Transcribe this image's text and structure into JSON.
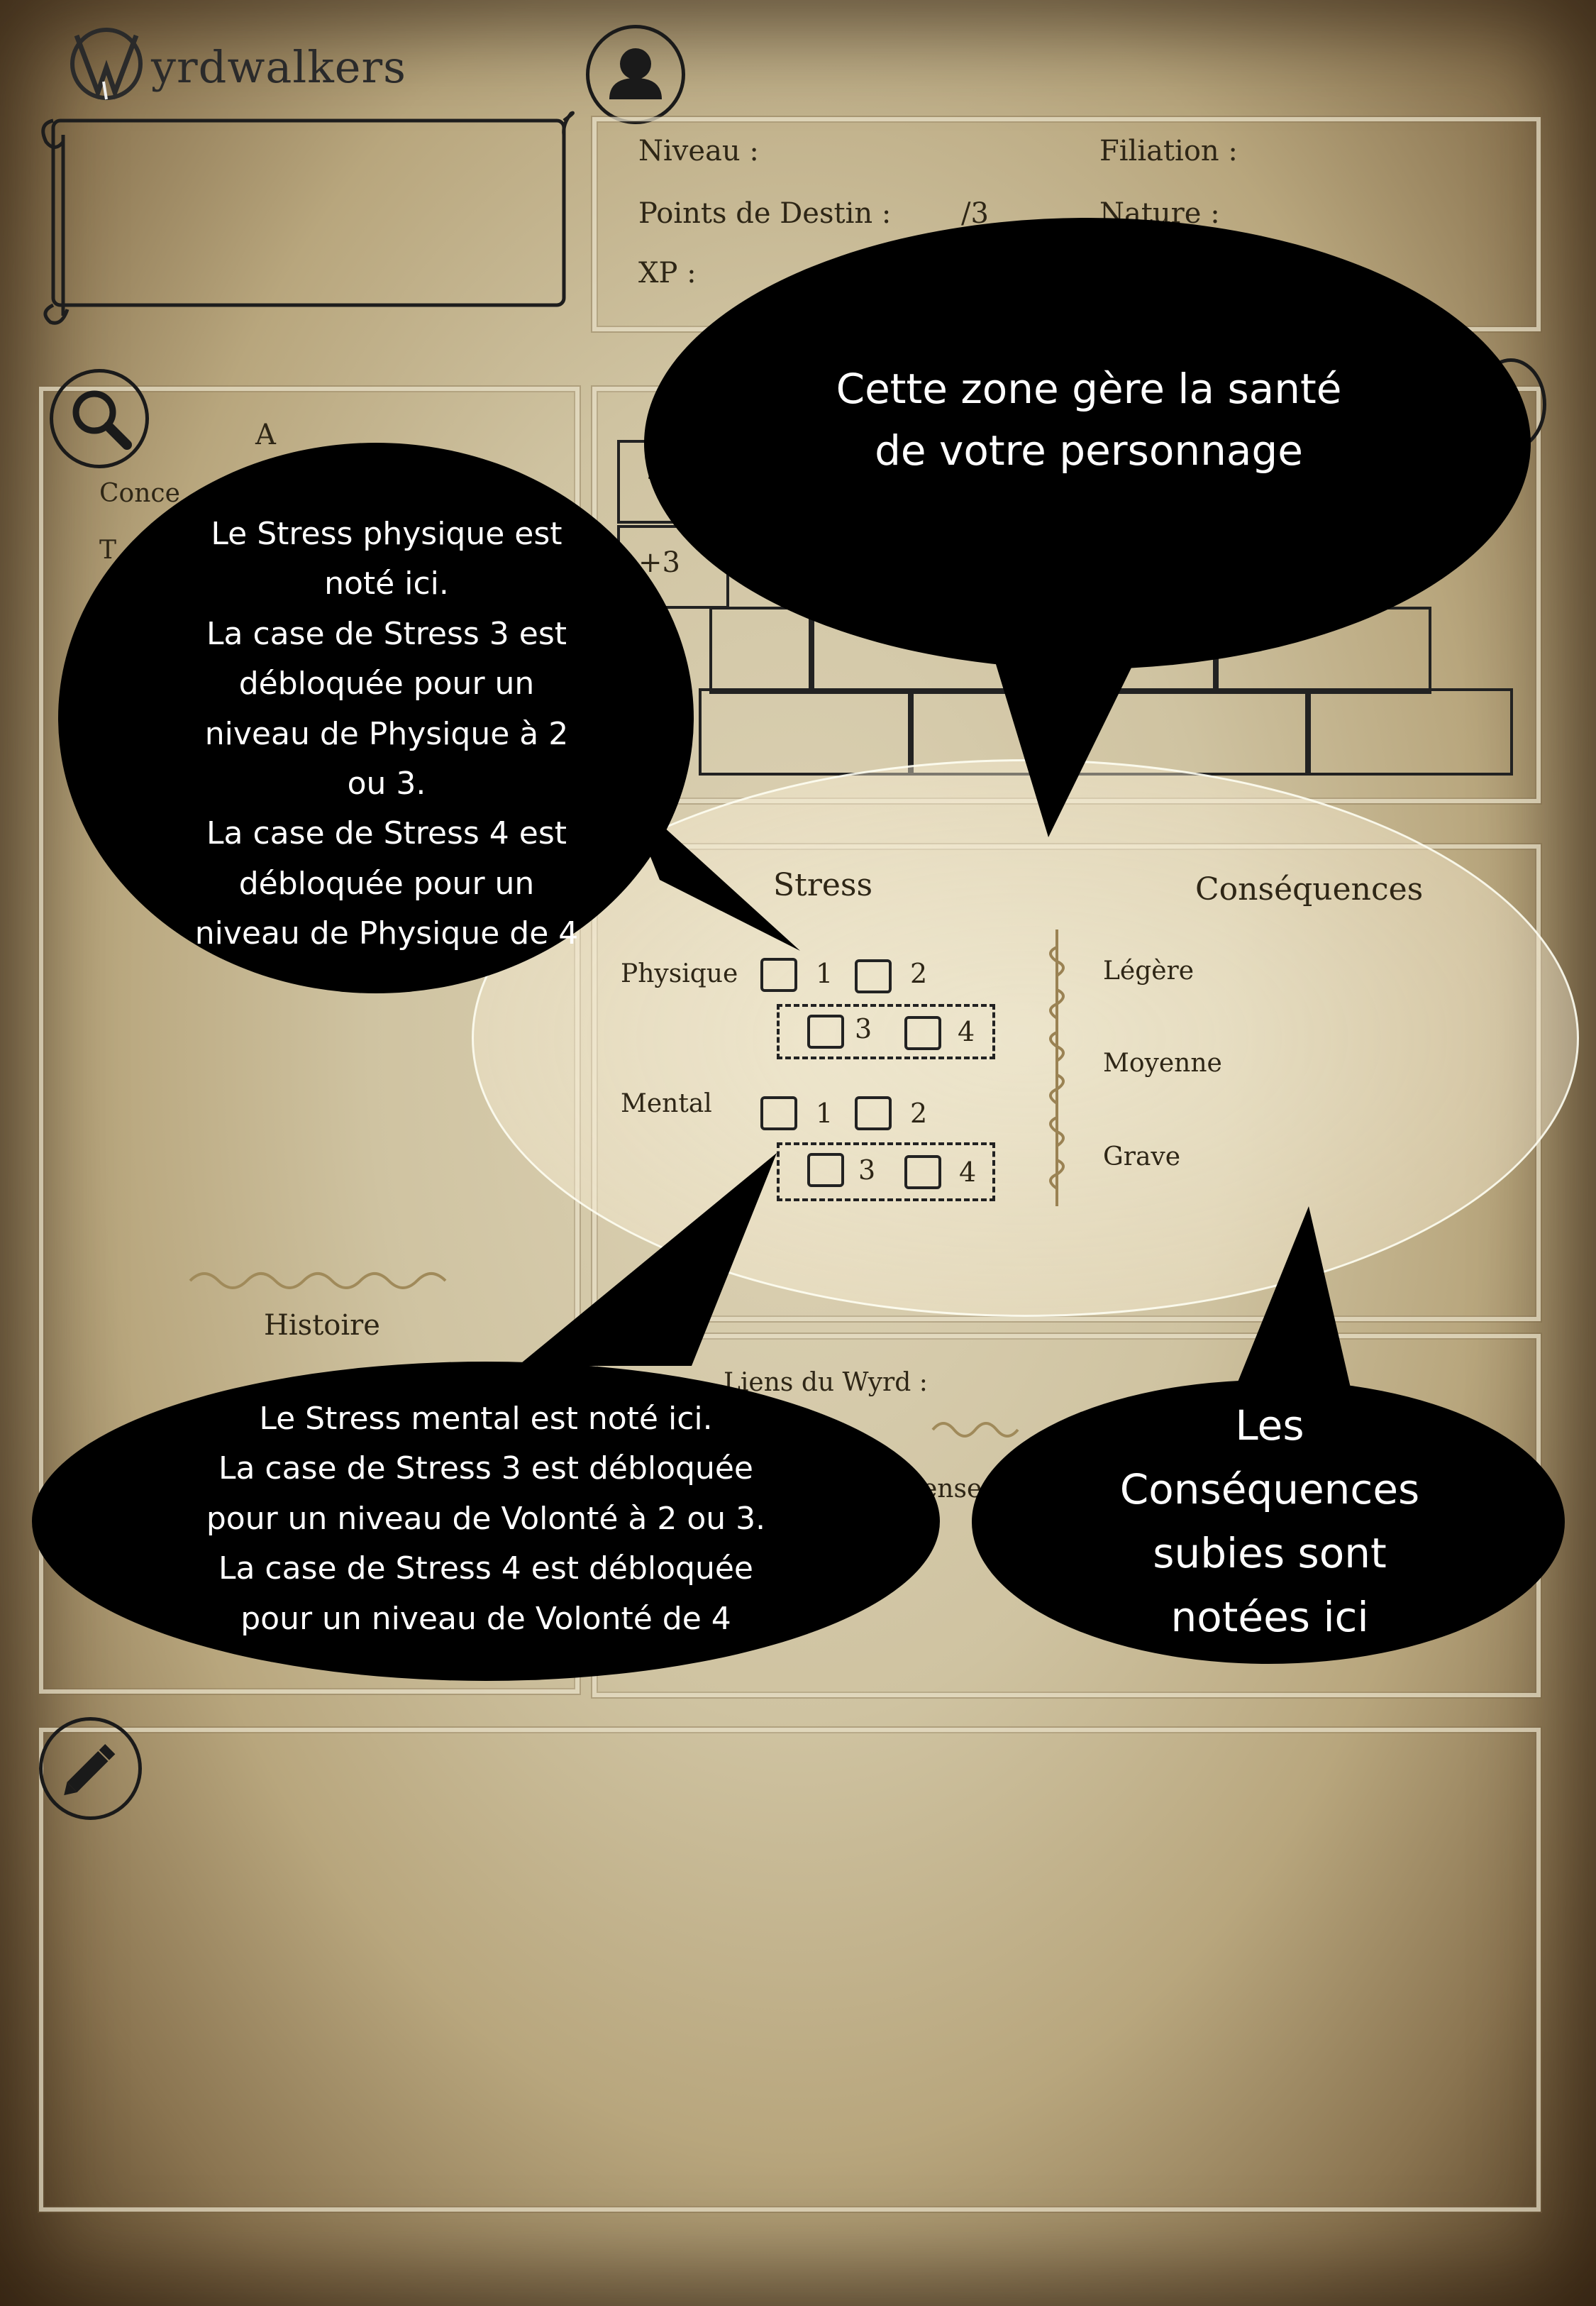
{
  "logo": {
    "text": "Wyrdwalkers",
    "first_letter": "W",
    "rest": "yrdwalkers"
  },
  "header_fields": {
    "niveau": "Niveau :",
    "points_destin": "Points de Destin :",
    "points_destin_value": "/3",
    "xp": "XP :",
    "filiation": "Filiation :",
    "nature": "Nature :"
  },
  "aspects_partial": {
    "a_letter": "A",
    "concept": "Conce",
    "t_letter": "T"
  },
  "skills_partial": {
    "plus4": "+",
    "plus3": "+3"
  },
  "health": {
    "stress_title": "Stress",
    "consequences_title": "Conséquences",
    "physique": "Physique",
    "mental": "Mental",
    "box1": "1",
    "box2": "2",
    "box3": "3",
    "box4": "4",
    "legere": "Légère",
    "moyenne": "Moyenne",
    "grave": "Grave"
  },
  "histoire": "Histoire",
  "liens": {
    "label": "Liens du Wyrd :",
    "partial": "ense"
  },
  "bubbles": {
    "zone": [
      "Cette zone gère la santé",
      "de votre personnage"
    ],
    "physique": [
      "Le Stress physique est",
      "noté ici.",
      "La case de Stress 3 est",
      "débloquée pour un",
      "niveau de Physique à 2",
      "ou 3.",
      "La case de Stress 4 est",
      "débloquée pour un",
      "niveau de Physique de 4"
    ],
    "mental": [
      "Le Stress mental est noté ici.",
      "La case de Stress 3 est débloquée",
      "pour un niveau de Volonté à 2 ou 3.",
      "La case de Stress 4 est débloquée",
      "pour un niveau de Volonté de 4"
    ],
    "consequences": [
      "Les",
      "Conséquences",
      "subies sont",
      "notées ici"
    ]
  },
  "icons": {
    "avatar": "person-icon",
    "search": "magnifier-icon",
    "edit": "pencil-icon",
    "logo": "wyrdwalkers-logo"
  }
}
